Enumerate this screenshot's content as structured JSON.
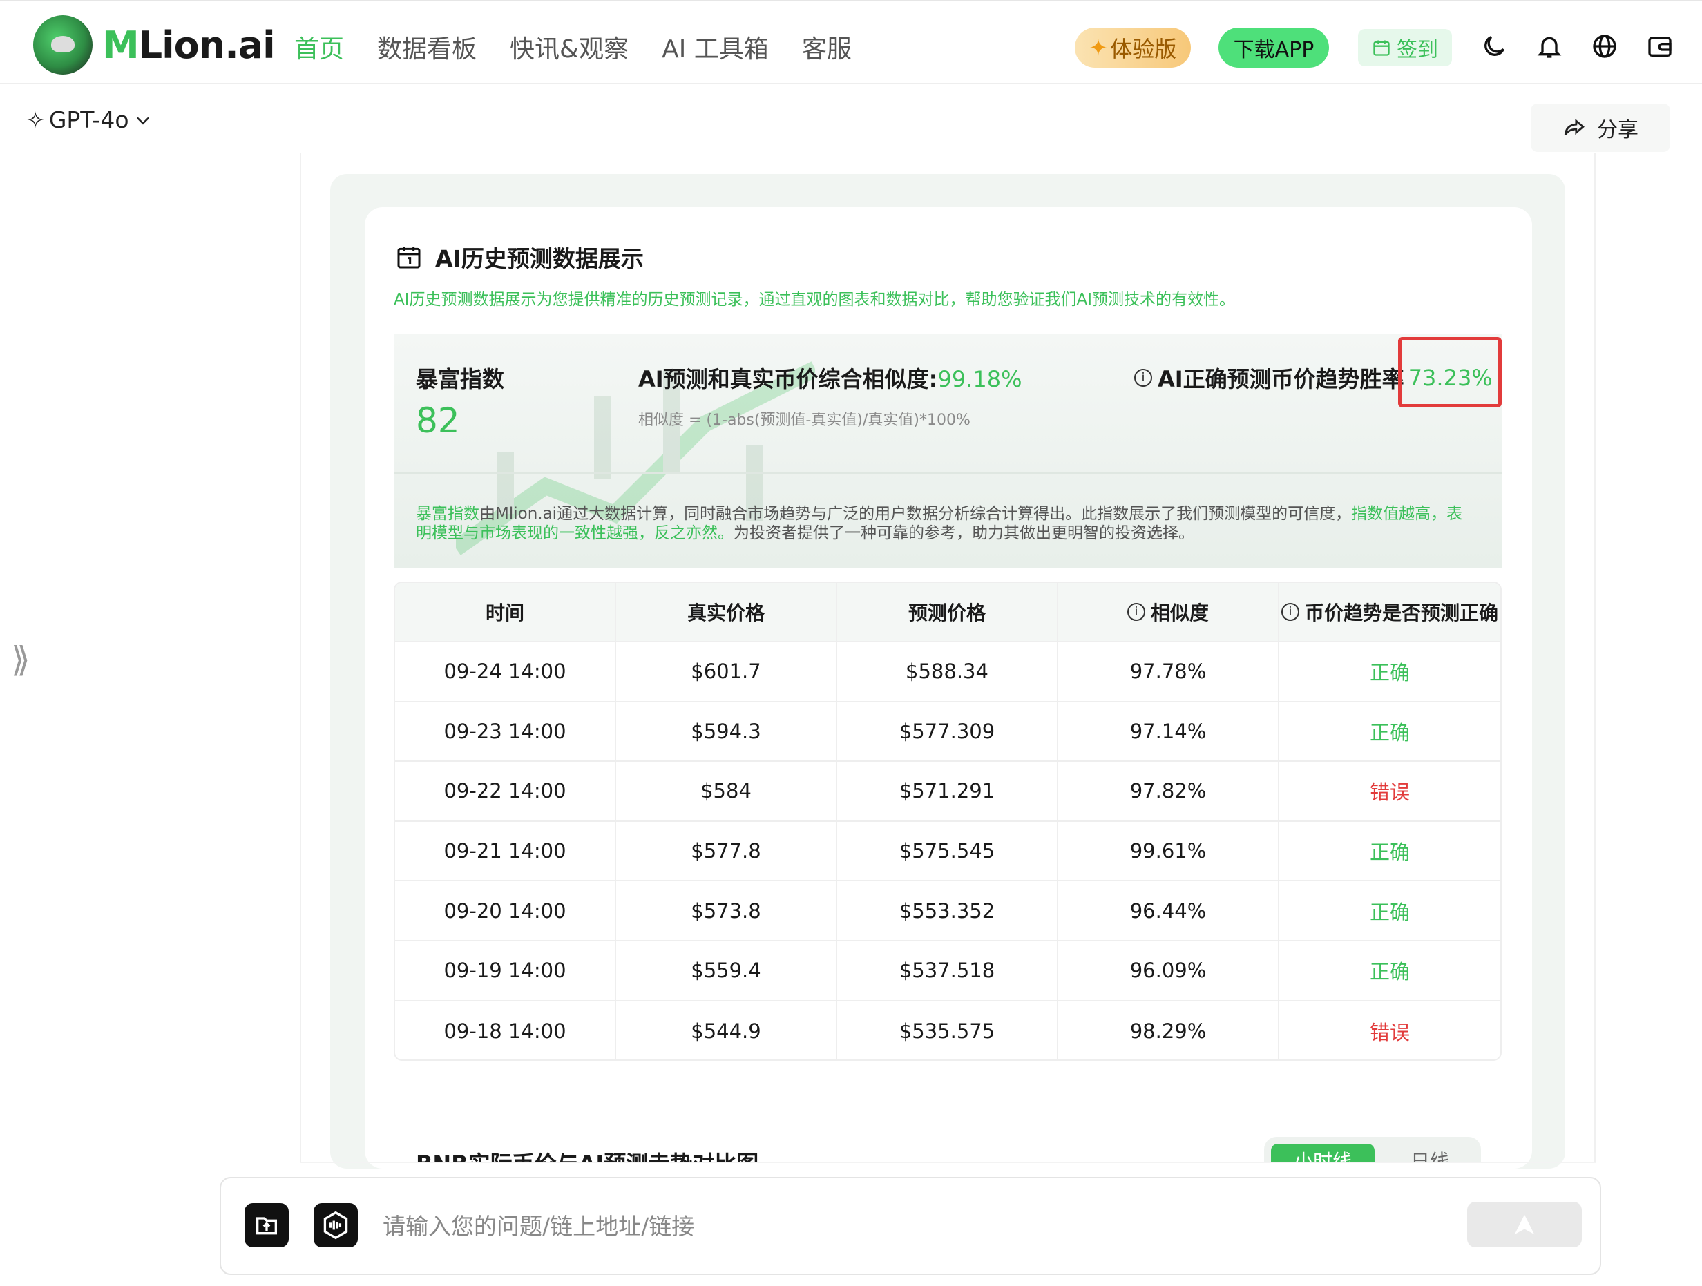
{
  "brand": {
    "name_m": "M",
    "name_rest": "Lion.ai"
  },
  "nav": [
    {
      "label": "首页",
      "active": true
    },
    {
      "label": "数据看板",
      "active": false
    },
    {
      "label": "快讯&观察",
      "active": false
    },
    {
      "label": "AI 工具箱",
      "active": false
    },
    {
      "label": "客服",
      "active": false
    }
  ],
  "header_actions": {
    "trial_label": "体验版",
    "app_label": "下载APP",
    "sign_label": "签到",
    "icons": [
      "moon-icon",
      "bell-icon",
      "globe-icon",
      "wallet-icon"
    ]
  },
  "model": {
    "selected": "GPT-4o"
  },
  "share_label": "分享",
  "card": {
    "title": "AI历史预测数据展示",
    "description": "AI历史预测数据展示为您提供精准的历史预测记录，通过直观的图表和数据对比，帮助您验证我们AI预测技术的有效性。"
  },
  "stats": {
    "index_label": "暴富指数",
    "index_value": "82",
    "similarity_label": "AI预测和真实币价综合相似度:",
    "similarity_value": "99.18%",
    "formula": "相似度 = (1-abs(预测值-真实值)/真实值)*100%",
    "winrate_label": "AI正确预测币价趋势胜率",
    "winrate_value": "73.23%",
    "note_lead": "暴富指数",
    "note_mid": "由Mlion.ai通过大数据计算，同时融合市场趋势与广泛的用户数据分析综合计算得出。此指数展示了我们预测模型的可信度，",
    "note_green": "指数值越高，表明模型与市场表现的一致性越强，反之亦然。",
    "note_tail": "为投资者提供了一种可靠的参考，助力其做出更明智的投资选择。"
  },
  "table": {
    "headers": [
      "时间",
      "真实价格",
      "预测价格",
      "相似度",
      "币价趋势是否预测正确"
    ],
    "rows": [
      [
        "09-24 14:00",
        "$601.7",
        "$588.34",
        "97.78%",
        "正确"
      ],
      [
        "09-23 14:00",
        "$594.3",
        "$577.309",
        "97.14%",
        "正确"
      ],
      [
        "09-22 14:00",
        "$584",
        "$571.291",
        "97.82%",
        "错误"
      ],
      [
        "09-21 14:00",
        "$577.8",
        "$575.545",
        "99.61%",
        "正确"
      ],
      [
        "09-20 14:00",
        "$573.8",
        "$553.352",
        "96.44%",
        "正确"
      ],
      [
        "09-19 14:00",
        "$559.4",
        "$537.518",
        "96.09%",
        "正确"
      ],
      [
        "09-18 14:00",
        "$544.9",
        "$535.575",
        "98.29%",
        "错误"
      ]
    ]
  },
  "chart_section": {
    "title": "BNB实际币价与AI预测走势对比图",
    "tab_active": "小时线",
    "tab_other": "日线"
  },
  "input": {
    "placeholder": "请输入您的问题/链上地址/链接"
  },
  "colors": {
    "accent": "#3cc05a",
    "error": "#e23b3b",
    "highlight_box": "#e23b3b"
  }
}
